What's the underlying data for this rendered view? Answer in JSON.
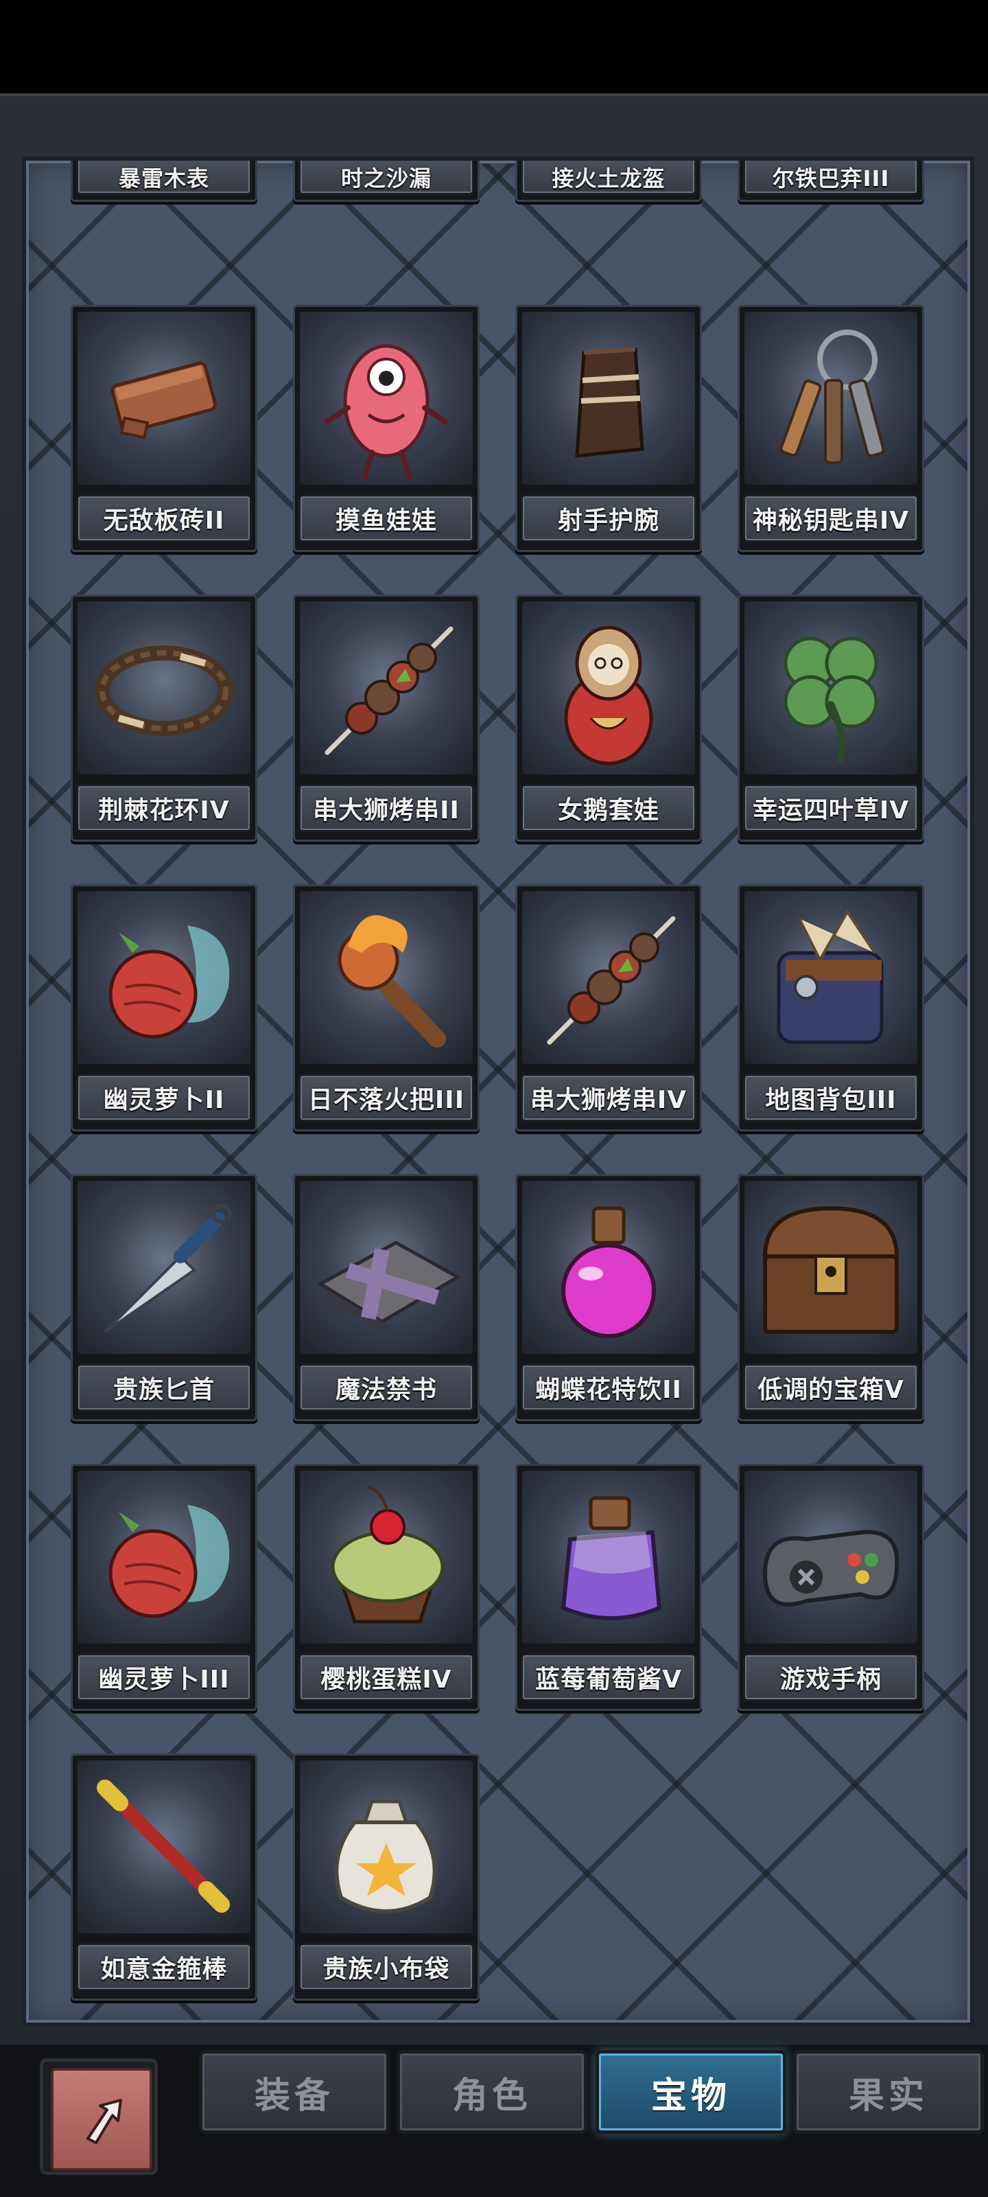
{
  "top_row_partial": [
    "暴雷木表",
    "时之沙漏",
    "接火土龙盔",
    "尔铁巴弃III"
  ],
  "items": [
    {
      "name": "无敌板砖II",
      "icon": "brick-icon"
    },
    {
      "name": "摸鱼娃娃",
      "icon": "pink-doll-icon"
    },
    {
      "name": "射手护腕",
      "icon": "bracer-icon"
    },
    {
      "name": "神秘钥匙串IV",
      "icon": "keys-icon"
    },
    {
      "name": "荆棘花环IV",
      "icon": "thorn-wreath-icon"
    },
    {
      "name": "串大狮烤串II",
      "icon": "kebab-icon"
    },
    {
      "name": "女鹅套娃",
      "icon": "matryoshka-icon"
    },
    {
      "name": "幸运四叶草IV",
      "icon": "four-leaf-clover-icon"
    },
    {
      "name": "幽灵萝卜II",
      "icon": "ghost-radish-icon"
    },
    {
      "name": "日不落火把III",
      "icon": "torch-icon"
    },
    {
      "name": "串大狮烤串IV",
      "icon": "kebab-icon"
    },
    {
      "name": "地图背包III",
      "icon": "map-bag-icon"
    },
    {
      "name": "贵族匕首",
      "icon": "dagger-icon"
    },
    {
      "name": "魔法禁书",
      "icon": "magic-book-icon"
    },
    {
      "name": "蝴蝶花特饮II",
      "icon": "pink-potion-icon"
    },
    {
      "name": "低调的宝箱V",
      "icon": "treasure-chest-icon"
    },
    {
      "name": "幽灵萝卜III",
      "icon": "ghost-radish-icon"
    },
    {
      "name": "樱桃蛋糕IV",
      "icon": "cherry-cake-icon"
    },
    {
      "name": "蓝莓葡萄酱V",
      "icon": "purple-jar-icon"
    },
    {
      "name": "游戏手柄",
      "icon": "gamepad-icon"
    },
    {
      "name": "如意金箍棒",
      "icon": "golden-staff-icon"
    },
    {
      "name": "贵族小布袋",
      "icon": "cloth-bag-icon"
    }
  ],
  "back_button_icon": "return-arrow-icon",
  "tabs": [
    {
      "label": "装备",
      "active": false
    },
    {
      "label": "角色",
      "active": false
    },
    {
      "label": "宝物",
      "active": true
    },
    {
      "label": "果实",
      "active": false
    }
  ],
  "colors": {
    "active_tab": "#2f6f95",
    "panel": "#4a5468",
    "back_button": "#c57b75"
  }
}
